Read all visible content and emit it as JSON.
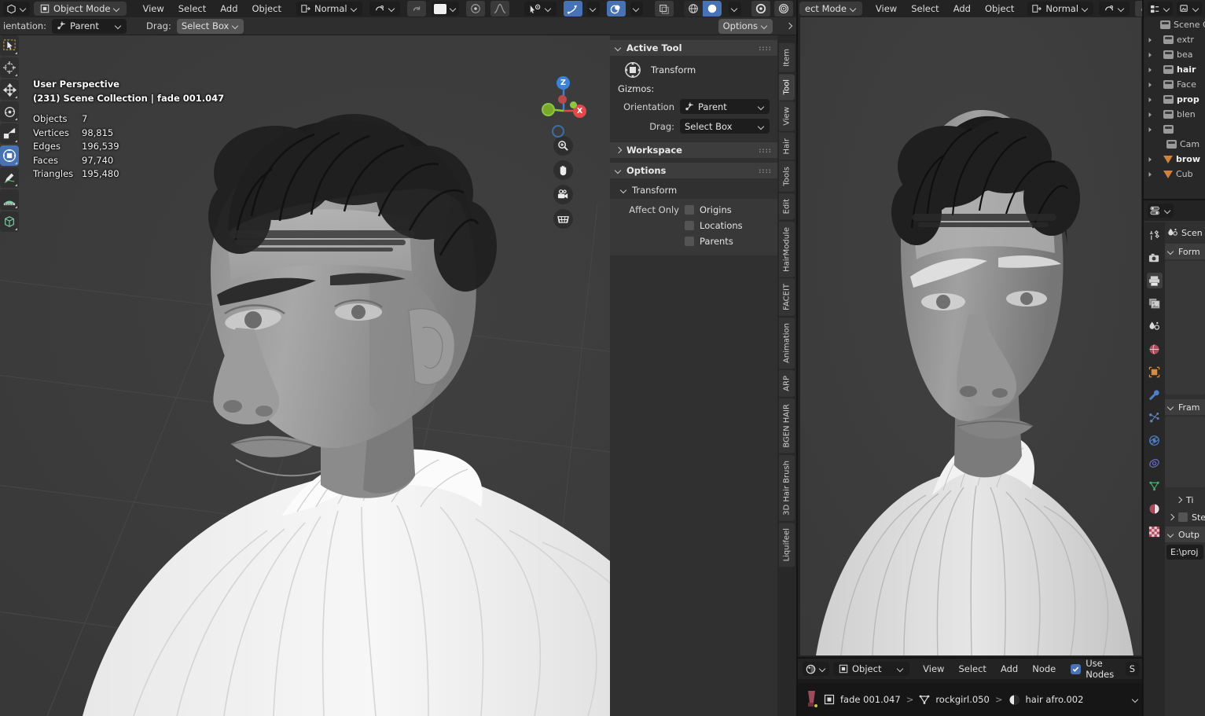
{
  "app": "Blender",
  "viewport1": {
    "header": {
      "editor_type": "editor-type-3dview",
      "mode": "Object Mode",
      "menus": [
        "View",
        "Select",
        "Add",
        "Object"
      ],
      "transform_orientation": "Normal",
      "snap_label": "snap",
      "proportional_label": "proportional-editing",
      "options_label": "Options"
    },
    "subheader": {
      "orientation_label": "ientation:",
      "orientation_value": "Parent",
      "drag_label": "Drag:",
      "drag_value": "Select Box"
    },
    "overlay_stats": {
      "perspective": "User Perspective",
      "scene_line": "(231) Scene Collection | fade 001.047",
      "rows": [
        {
          "label": "Objects",
          "value": "7"
        },
        {
          "label": "Vertices",
          "value": "98,815"
        },
        {
          "label": "Edges",
          "value": "196,539"
        },
        {
          "label": "Faces",
          "value": "97,740"
        },
        {
          "label": "Triangles",
          "value": "195,480"
        }
      ]
    },
    "gizmo": {
      "axis_z": "Z",
      "axis_x": "X",
      "axis_y": ""
    },
    "nav_buttons": [
      "zoom-icon",
      "pan-hand-icon",
      "camera-view-icon",
      "toggle-ortho-grid-icon"
    ]
  },
  "toolbar": {
    "tools": [
      {
        "name": "tweak-select-box-tool",
        "active": false
      },
      {
        "name": "cursor-tool",
        "active": false
      },
      {
        "name": "move-tool",
        "active": false
      },
      {
        "name": "rotate-tool",
        "active": false
      },
      {
        "name": "scale-tool",
        "active": false
      },
      {
        "name": "transform-tool",
        "active": true
      },
      {
        "name": "annotate-tool",
        "active": false
      },
      {
        "name": "measure-tool",
        "active": false
      },
      {
        "name": "add-cube-tool",
        "active": false
      }
    ]
  },
  "npanel": {
    "active_tool": {
      "title": "Active Tool",
      "tool_name": "Transform",
      "gizmos_label": "Gizmos:",
      "orientation_label": "Orientation",
      "orientation_value": "Parent",
      "drag_label": "Drag:",
      "drag_value": "Select Box"
    },
    "workspace": {
      "title": "Workspace"
    },
    "options": {
      "title": "Options",
      "transform_title": "Transform",
      "affect_only_label": "Affect Only",
      "checkboxes": [
        {
          "label": "Origins",
          "checked": false
        },
        {
          "label": "Locations",
          "checked": false
        },
        {
          "label": "Parents",
          "checked": false
        }
      ]
    },
    "tabs": [
      "Item",
      "Tool",
      "View",
      "Hair",
      "Tools",
      "Edit",
      "HairModule",
      "FACEIT",
      "Animation",
      "ARP",
      "BGEN HAIR",
      "3D Hair Brush",
      "Liquifeel"
    ],
    "active_tab": "Tool"
  },
  "viewport2": {
    "header": {
      "mode": "ect Mode",
      "menus": [
        "View",
        "Select",
        "Add",
        "Object"
      ],
      "transform_orientation": "Normal"
    }
  },
  "node_editor": {
    "header": {
      "editor_type": "shader-editor-icon",
      "shader_type": "Object",
      "menus": [
        "View",
        "Select",
        "Add",
        "Node"
      ],
      "use_nodes_label": "Use Nodes",
      "use_nodes_checked": true,
      "slot_label": "S"
    },
    "breadcrumb": [
      "fade 001.047",
      "rockgirl.050",
      "hair afro.002"
    ],
    "breadcrumb_sep": ">"
  },
  "outliner": {
    "header": {
      "display_mode": "outliner-display-mode",
      "filter": "filter-icon"
    },
    "rows": [
      {
        "label": "Scene C",
        "type": "collection",
        "bold": false,
        "indent": 0,
        "disclose": false
      },
      {
        "label": "extr",
        "type": "collection",
        "bold": false,
        "indent": 1,
        "disclose": true
      },
      {
        "label": "bea",
        "type": "collection",
        "bold": false,
        "indent": 1,
        "disclose": true
      },
      {
        "label": "hair",
        "type": "collection",
        "bold": true,
        "indent": 1,
        "disclose": true
      },
      {
        "label": "Face",
        "type": "collection",
        "bold": false,
        "indent": 1,
        "disclose": true
      },
      {
        "label": "prop",
        "type": "collection",
        "bold": true,
        "indent": 1,
        "disclose": true
      },
      {
        "label": "blen",
        "type": "collection",
        "bold": false,
        "indent": 1,
        "disclose": true
      },
      {
        "label": "",
        "type": "collection",
        "bold": false,
        "indent": 1,
        "disclose": true
      },
      {
        "label": "Cam",
        "type": "collection",
        "bold": false,
        "indent": 2,
        "disclose": false
      },
      {
        "label": "brow",
        "type": "mesh",
        "bold": true,
        "indent": 1,
        "disclose": true
      },
      {
        "label": "Cub",
        "type": "mesh",
        "bold": false,
        "indent": 1,
        "disclose": true
      }
    ]
  },
  "properties": {
    "breadcrumb_label": "Scen",
    "tabs": [
      {
        "name": "tool-properties-tab",
        "active": false
      },
      {
        "name": "render-properties-tab",
        "active": false
      },
      {
        "name": "output-properties-tab",
        "active": true
      },
      {
        "name": "viewlayer-properties-tab",
        "active": false
      },
      {
        "name": "scene-properties-tab",
        "active": false
      },
      {
        "name": "world-properties-tab",
        "active": false
      },
      {
        "name": "object-properties-tab",
        "active": false
      },
      {
        "name": "modifier-properties-tab",
        "active": false
      },
      {
        "name": "particles-properties-tab",
        "active": false
      },
      {
        "name": "physics-properties-tab",
        "active": false
      },
      {
        "name": "constraint-properties-tab",
        "active": false
      },
      {
        "name": "data-properties-tab",
        "active": false
      },
      {
        "name": "material-properties-tab",
        "active": false
      },
      {
        "name": "texture-properties-tab",
        "active": false
      }
    ],
    "panels": [
      {
        "label": "Form",
        "open": true
      },
      {
        "label": "Fram",
        "open": true
      },
      {
        "label": "Ti",
        "open": false
      },
      {
        "label": "Ste",
        "open": false
      },
      {
        "label": "Outp",
        "open": true
      }
    ],
    "output_path": "E:\\proj"
  },
  "colors": {
    "accent_blue": "#4772b3",
    "viewport_bg": "#3b3b3b",
    "panel_bg": "#303030",
    "header_bg": "#232323",
    "axis_x": "#e04a4a",
    "axis_y": "#8dc63f",
    "axis_z": "#3b83d8"
  }
}
